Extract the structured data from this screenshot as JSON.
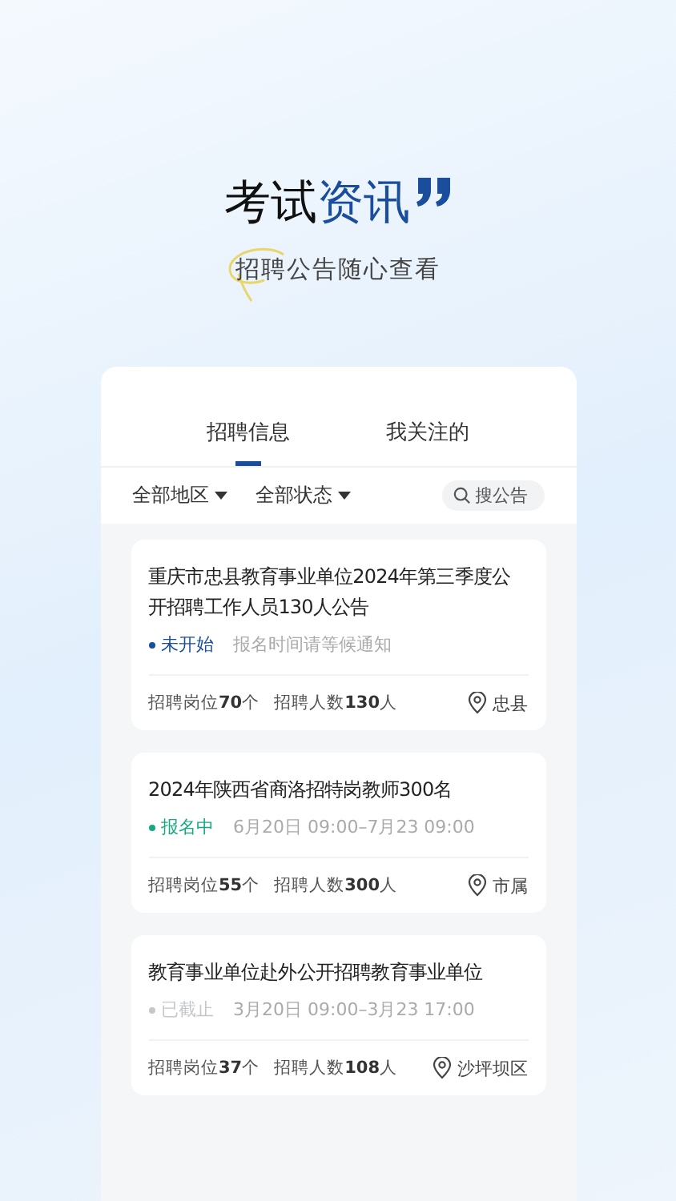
{
  "banner": {
    "title_plain": "考试",
    "title_accent": "资讯",
    "subtitle": "招聘公告随心查看"
  },
  "tabs": [
    {
      "label": "招聘信息",
      "selected": true
    },
    {
      "label": "我关注的",
      "selected": false
    }
  ],
  "filters": [
    "全部地区",
    "全部状态"
  ],
  "search": {
    "placeholder": "搜公告"
  },
  "notices": [
    {
      "title": "重庆市忠县教育事业单位2024年第三季度公开招聘工作人员130人公告",
      "status": "未开始",
      "color": "#1a4e9c",
      "time": "报名时间请等候通知",
      "positions": "招聘岗位**70**个",
      "people": "招聘人数**130**人",
      "location": "忠县"
    },
    {
      "title": "2024年陕西省商洛招特岗教师300名",
      "status": "报名中",
      "color": "#17a882",
      "time": "6月20日 09:00–7月23 09:00",
      "positions": "招聘岗位**55**个",
      "people": "招聘人数**300**人",
      "location": "市属"
    },
    {
      "title": "教育事业单位赴外公开招聘教育事业单位",
      "status": "已截止",
      "color": "#c4c8cc",
      "time": "3月20日 09:00–3月23 17:00",
      "positions": "招聘岗位**37**个",
      "people": "招聘人数**108**人",
      "location": "沙坪坝区"
    }
  ]
}
